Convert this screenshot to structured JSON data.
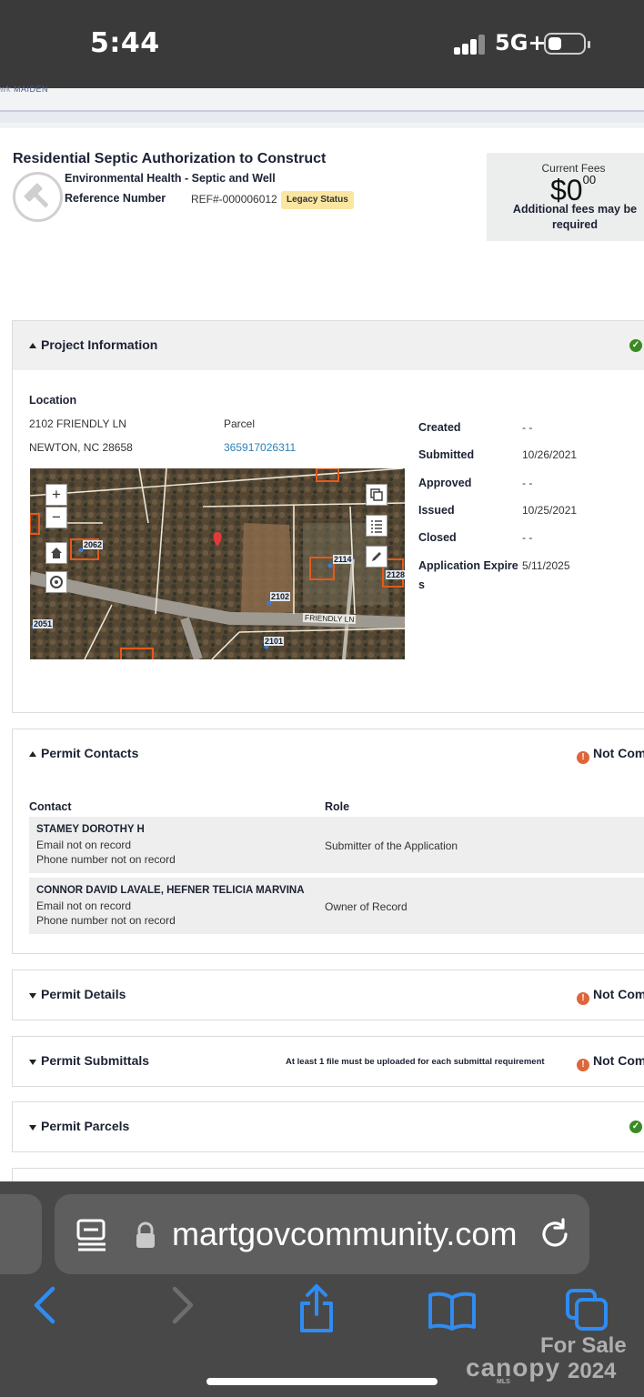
{
  "status_bar": {
    "time": "5:44",
    "network": "5G+"
  },
  "site": {
    "logo_fragment": "MAIDEN"
  },
  "record": {
    "title": "Residential Septic Authorization to Construct",
    "department": "Environmental Health - Septic and Well",
    "reference_label": "Reference Number",
    "reference_value": "REF#-000006012",
    "legacy_badge": "Legacy Status",
    "icon": "hammer-icon"
  },
  "fees": {
    "label": "Current Fees",
    "dollars": "$0",
    "cents": "00",
    "note": "Additional fees may be required"
  },
  "project_info": {
    "title": "Project Information",
    "location_label": "Location",
    "address_line1": "2102 FRIENDLY LN",
    "address_line2": "NEWTON, NC 28658",
    "parcel_label": "Parcel",
    "parcel_value": "365917026311",
    "map": {
      "road_label": "FRIENDLY LN",
      "house_labels": [
        "2062",
        "2114",
        "2128",
        "2102",
        "2051",
        "2101"
      ],
      "zoom_in": "+",
      "zoom_out": "−"
    },
    "dates": [
      {
        "label": "Created",
        "value": "- -"
      },
      {
        "label": "Submitted",
        "value": "10/26/2021"
      },
      {
        "label": "Approved",
        "value": "- -"
      },
      {
        "label": "Issued",
        "value": "10/25/2021"
      },
      {
        "label": "Closed",
        "value": "- -"
      },
      {
        "label": "Application Expire",
        "label_wrap": "s",
        "value": "5/11/2025"
      }
    ]
  },
  "contacts": {
    "title": "Permit Contacts",
    "status": "Not Com",
    "col_contact": "Contact",
    "col_role": "Role",
    "rows": [
      {
        "name": "STAMEY DOROTHY H",
        "email": "Email not on record",
        "phone": "Phone number not on record",
        "role": "Submitter of the Application"
      },
      {
        "name": "CONNOR DAVID LAVALE, HEFNER TELICIA MARVINA",
        "email": "Email not on record",
        "phone": "Phone number not on record",
        "role": "Owner of Record"
      }
    ]
  },
  "permit_details": {
    "title": "Permit Details",
    "status": "Not Com"
  },
  "permit_submittals": {
    "title": "Permit Submittals",
    "note": "At least 1 file must be uploaded for each submittal requirement",
    "status": "Not Com"
  },
  "permit_parcels": {
    "title": "Permit Parcels"
  },
  "safari": {
    "url": " martgovcommunity.com"
  },
  "watermark": {
    "line1": "For Sale",
    "brand": "canopy",
    "year": "2024",
    "mls": "MLS"
  }
}
